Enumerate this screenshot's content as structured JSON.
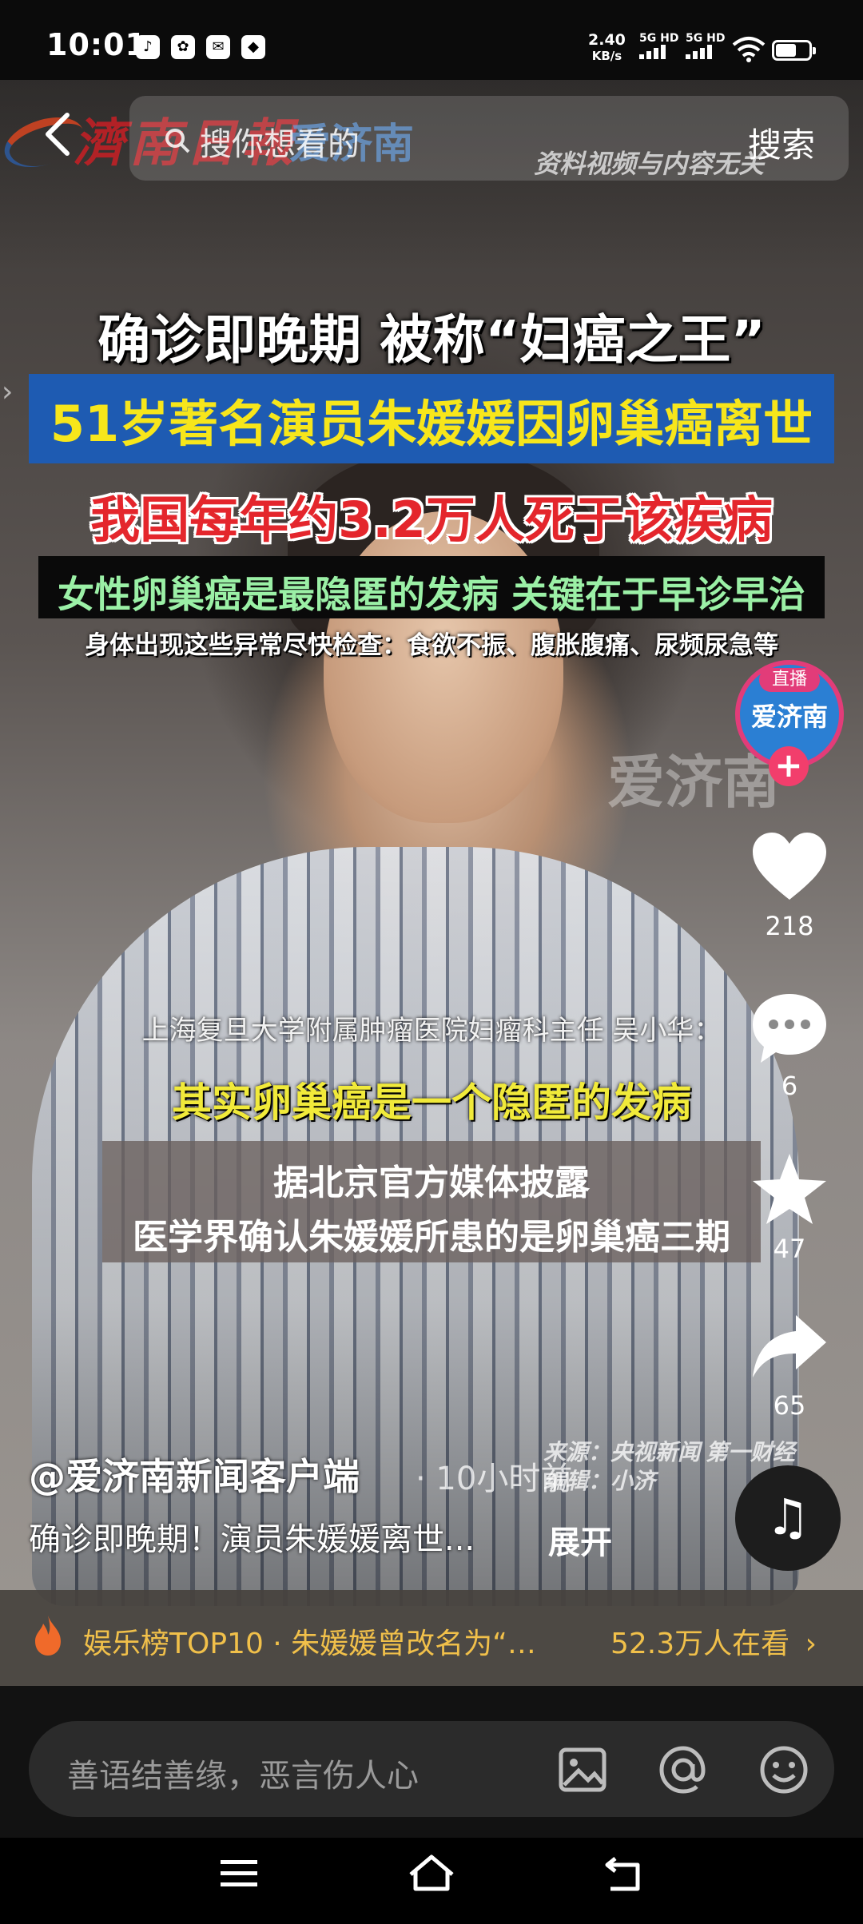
{
  "status_bar": {
    "time": "10:01",
    "net_speed_value": "2.40",
    "net_speed_unit": "KB/s",
    "signal1_label": "5G HD",
    "signal2_label": "5G HD",
    "notification_icons": [
      "qq-music-icon",
      "baidu-icon",
      "mail-icon",
      "app-icon"
    ]
  },
  "top": {
    "search_placeholder": "搜你想看的",
    "search_button": "搜索",
    "logo_text": "濟南日報",
    "logo2_text": "爱济南",
    "disclaimer": "资料视频与内容无关"
  },
  "video": {
    "headline1": "确诊即晚期 被称“妇癌之王”",
    "headline2": "51岁著名演员朱媛媛因卵巢癌离世",
    "headline3": "我国每年约3.2万人死于该疾病",
    "headline4": "女性卵巢癌是最隐匿的发病 关键在于早诊早治",
    "symptoms": "身体出现这些异常尽快检查：食欲不振、腹胀腹痛、尿频尿急等",
    "watermark": "爱济南",
    "doctor": "上海复旦大学附属肿瘤医院妇瘤科主任 吴小华：",
    "quote": "其实卵巢癌是一个隐匿的发病",
    "caption_line1": "据北京官方媒体披露",
    "caption_line2": "医学界确认朱媛媛所患的是卵巢癌三期",
    "source_line1": "来源：央视新闻 第一财经",
    "source_line2": "编辑：小济"
  },
  "rail": {
    "live_tag": "直播",
    "live_name": "爱济南",
    "follow": "+",
    "likes": "218",
    "comments": "6",
    "favorites": "47",
    "shares": "65"
  },
  "post": {
    "author": "@爱济南新闻客户端",
    "time_ago": "· 10小时前",
    "description": "确诊即晚期！演员朱媛媛离世...",
    "expand": "展开"
  },
  "trend": {
    "text": "娱乐榜TOP10 · 朱媛媛曾改名为“…",
    "viewers": "52.3万人在看",
    "chevron": "›"
  },
  "comment": {
    "placeholder": "善语结善缘，恶言伤人心"
  },
  "colors": {
    "headline_blue": "#1e5bb2",
    "headline_yellow": "#f7e61b",
    "headline_red": "#e4262c",
    "headline_green": "#9bf0a6",
    "trend_gold": "#f1c04a",
    "follow_pink": "#f23e6c"
  }
}
